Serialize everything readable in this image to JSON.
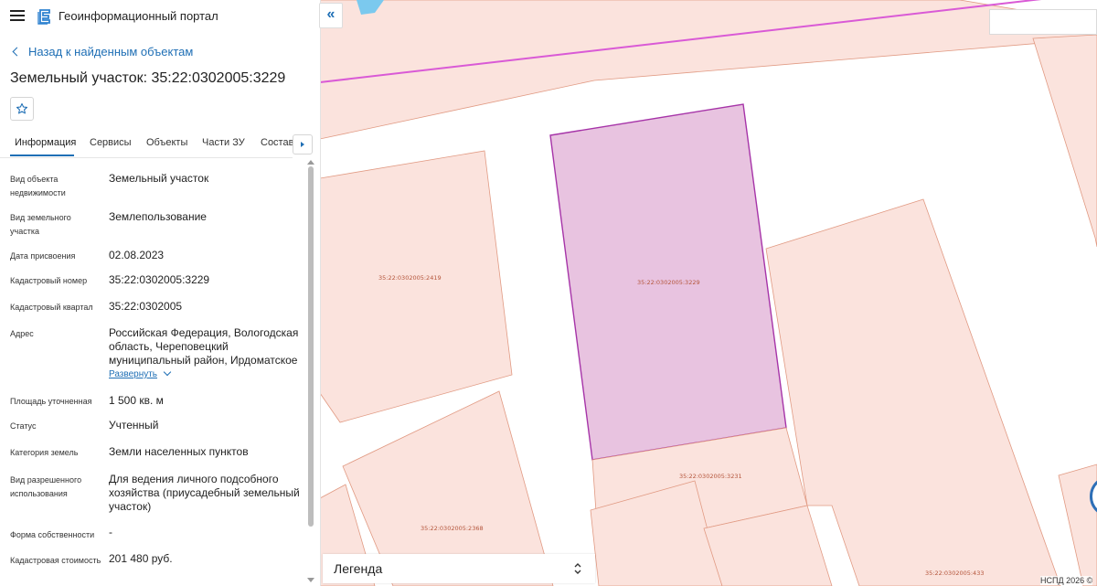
{
  "app": {
    "title": "Геоинформационный портал"
  },
  "nav": {
    "back_label": "Назад к найденным объектам"
  },
  "object": {
    "title": "Земельный участок: 35:22:0302005:3229"
  },
  "tabs": [
    {
      "label": "Информация"
    },
    {
      "label": "Сервисы"
    },
    {
      "label": "Объекты"
    },
    {
      "label": "Части ЗУ"
    },
    {
      "label": "Состав"
    }
  ],
  "info": [
    {
      "label": "Вид объекта недвижимости",
      "value": "Земельный участок"
    },
    {
      "label": "Вид земельного участка",
      "value": "Землепользование"
    },
    {
      "label": "Дата присвоения",
      "value": "02.08.2023"
    },
    {
      "label": "Кадастровый номер",
      "value": "35:22:0302005:3229"
    },
    {
      "label": "Кадастровый квартал",
      "value": "35:22:0302005"
    },
    {
      "label": "Адрес",
      "value": "Российская Федерация, Вологодская область, Череповецкий муниципальный район, Ирдоматское"
    },
    {
      "label": "Площадь уточненная",
      "value": "1 500 кв. м"
    },
    {
      "label": "Статус",
      "value": "Учтенный"
    },
    {
      "label": "Категория земель",
      "value": "Земли населенных пунктов"
    },
    {
      "label": "Вид разрешенного использования",
      "value": "Для ведения личного подсобного хозяйства (приусадебный земельный участок)"
    },
    {
      "label": "Форма собственности",
      "value": "-"
    },
    {
      "label": "Кадастровая стоимость",
      "value": "201 480 руб."
    }
  ],
  "address_expand_label": "Развернуть",
  "map": {
    "parcel_labels": [
      "35:22:0302005:2419",
      "35:22:0302005:3229",
      "35:22:0302005:3231",
      "35:22:0302005:2368",
      "35:22:0302005:433"
    ],
    "legend_label": "Легенда",
    "copyright": "НСПД 2026 ©"
  },
  "colors": {
    "accent": "#1f6fb5",
    "parcel_fill": "#fbe3dd",
    "parcel_stroke": "#e19a83",
    "selected_fill": "#e8c3e0",
    "selected_stroke": "#a634a8",
    "boundary_line": "#d95ad6"
  }
}
